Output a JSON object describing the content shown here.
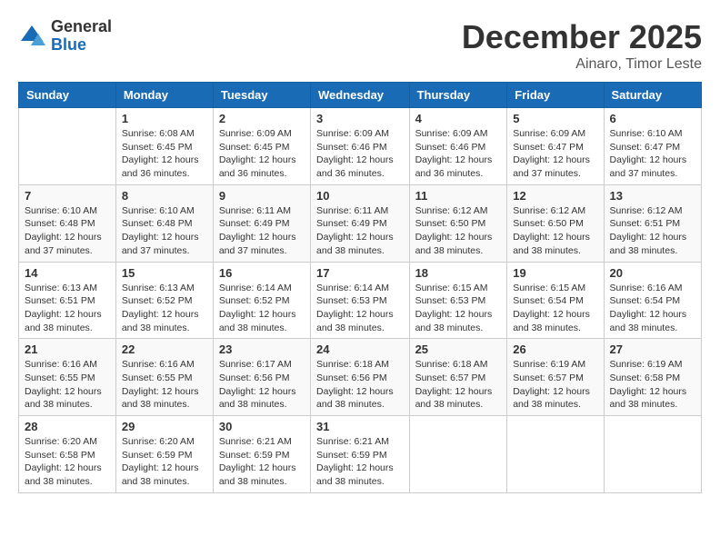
{
  "logo": {
    "general": "General",
    "blue": "Blue"
  },
  "header": {
    "month": "December 2025",
    "location": "Ainaro, Timor Leste"
  },
  "weekdays": [
    "Sunday",
    "Monday",
    "Tuesday",
    "Wednesday",
    "Thursday",
    "Friday",
    "Saturday"
  ],
  "weeks": [
    [
      {
        "day": "",
        "info": ""
      },
      {
        "day": "1",
        "info": "Sunrise: 6:08 AM\nSunset: 6:45 PM\nDaylight: 12 hours\nand 36 minutes."
      },
      {
        "day": "2",
        "info": "Sunrise: 6:09 AM\nSunset: 6:45 PM\nDaylight: 12 hours\nand 36 minutes."
      },
      {
        "day": "3",
        "info": "Sunrise: 6:09 AM\nSunset: 6:46 PM\nDaylight: 12 hours\nand 36 minutes."
      },
      {
        "day": "4",
        "info": "Sunrise: 6:09 AM\nSunset: 6:46 PM\nDaylight: 12 hours\nand 36 minutes."
      },
      {
        "day": "5",
        "info": "Sunrise: 6:09 AM\nSunset: 6:47 PM\nDaylight: 12 hours\nand 37 minutes."
      },
      {
        "day": "6",
        "info": "Sunrise: 6:10 AM\nSunset: 6:47 PM\nDaylight: 12 hours\nand 37 minutes."
      }
    ],
    [
      {
        "day": "7",
        "info": "Sunrise: 6:10 AM\nSunset: 6:48 PM\nDaylight: 12 hours\nand 37 minutes."
      },
      {
        "day": "8",
        "info": "Sunrise: 6:10 AM\nSunset: 6:48 PM\nDaylight: 12 hours\nand 37 minutes."
      },
      {
        "day": "9",
        "info": "Sunrise: 6:11 AM\nSunset: 6:49 PM\nDaylight: 12 hours\nand 37 minutes."
      },
      {
        "day": "10",
        "info": "Sunrise: 6:11 AM\nSunset: 6:49 PM\nDaylight: 12 hours\nand 38 minutes."
      },
      {
        "day": "11",
        "info": "Sunrise: 6:12 AM\nSunset: 6:50 PM\nDaylight: 12 hours\nand 38 minutes."
      },
      {
        "day": "12",
        "info": "Sunrise: 6:12 AM\nSunset: 6:50 PM\nDaylight: 12 hours\nand 38 minutes."
      },
      {
        "day": "13",
        "info": "Sunrise: 6:12 AM\nSunset: 6:51 PM\nDaylight: 12 hours\nand 38 minutes."
      }
    ],
    [
      {
        "day": "14",
        "info": "Sunrise: 6:13 AM\nSunset: 6:51 PM\nDaylight: 12 hours\nand 38 minutes."
      },
      {
        "day": "15",
        "info": "Sunrise: 6:13 AM\nSunset: 6:52 PM\nDaylight: 12 hours\nand 38 minutes."
      },
      {
        "day": "16",
        "info": "Sunrise: 6:14 AM\nSunset: 6:52 PM\nDaylight: 12 hours\nand 38 minutes."
      },
      {
        "day": "17",
        "info": "Sunrise: 6:14 AM\nSunset: 6:53 PM\nDaylight: 12 hours\nand 38 minutes."
      },
      {
        "day": "18",
        "info": "Sunrise: 6:15 AM\nSunset: 6:53 PM\nDaylight: 12 hours\nand 38 minutes."
      },
      {
        "day": "19",
        "info": "Sunrise: 6:15 AM\nSunset: 6:54 PM\nDaylight: 12 hours\nand 38 minutes."
      },
      {
        "day": "20",
        "info": "Sunrise: 6:16 AM\nSunset: 6:54 PM\nDaylight: 12 hours\nand 38 minutes."
      }
    ],
    [
      {
        "day": "21",
        "info": "Sunrise: 6:16 AM\nSunset: 6:55 PM\nDaylight: 12 hours\nand 38 minutes."
      },
      {
        "day": "22",
        "info": "Sunrise: 6:16 AM\nSunset: 6:55 PM\nDaylight: 12 hours\nand 38 minutes."
      },
      {
        "day": "23",
        "info": "Sunrise: 6:17 AM\nSunset: 6:56 PM\nDaylight: 12 hours\nand 38 minutes."
      },
      {
        "day": "24",
        "info": "Sunrise: 6:18 AM\nSunset: 6:56 PM\nDaylight: 12 hours\nand 38 minutes."
      },
      {
        "day": "25",
        "info": "Sunrise: 6:18 AM\nSunset: 6:57 PM\nDaylight: 12 hours\nand 38 minutes."
      },
      {
        "day": "26",
        "info": "Sunrise: 6:19 AM\nSunset: 6:57 PM\nDaylight: 12 hours\nand 38 minutes."
      },
      {
        "day": "27",
        "info": "Sunrise: 6:19 AM\nSunset: 6:58 PM\nDaylight: 12 hours\nand 38 minutes."
      }
    ],
    [
      {
        "day": "28",
        "info": "Sunrise: 6:20 AM\nSunset: 6:58 PM\nDaylight: 12 hours\nand 38 minutes."
      },
      {
        "day": "29",
        "info": "Sunrise: 6:20 AM\nSunset: 6:59 PM\nDaylight: 12 hours\nand 38 minutes."
      },
      {
        "day": "30",
        "info": "Sunrise: 6:21 AM\nSunset: 6:59 PM\nDaylight: 12 hours\nand 38 minutes."
      },
      {
        "day": "31",
        "info": "Sunrise: 6:21 AM\nSunset: 6:59 PM\nDaylight: 12 hours\nand 38 minutes."
      },
      {
        "day": "",
        "info": ""
      },
      {
        "day": "",
        "info": ""
      },
      {
        "day": "",
        "info": ""
      }
    ]
  ]
}
